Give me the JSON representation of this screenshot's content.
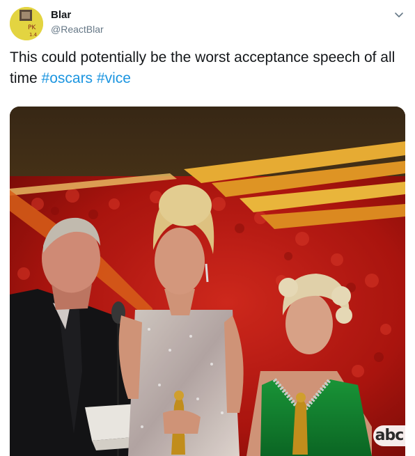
{
  "author": {
    "display_name": "Blar",
    "handle": "@ReactBlar",
    "avatar_icon": "avatar-image"
  },
  "tweet": {
    "text": "This could potentially be the worst acceptance speech of all time",
    "hashtags": [
      "#oscars",
      "#vice"
    ]
  },
  "media": {
    "watermark": "abc"
  },
  "menu_icon": "chevron-down-icon",
  "colors": {
    "hashtag": "#1b95e0",
    "text": "#14171a",
    "secondary_text": "#657786"
  }
}
